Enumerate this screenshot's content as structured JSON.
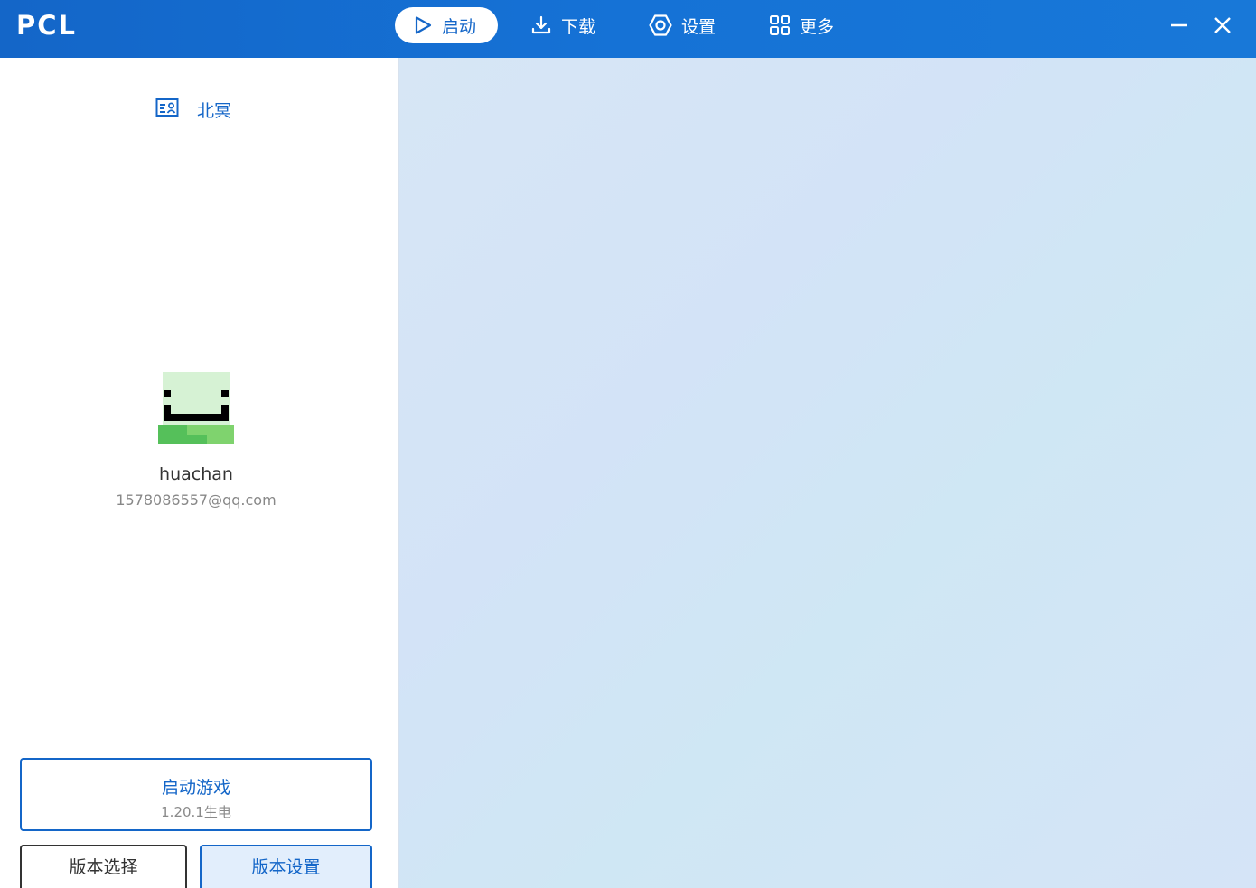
{
  "app": {
    "logo": "PCL"
  },
  "nav": {
    "items": [
      {
        "label": "启动",
        "icon": "play-icon",
        "active": true
      },
      {
        "label": "下载",
        "icon": "download-icon",
        "active": false
      },
      {
        "label": "设置",
        "icon": "settings-icon",
        "active": false
      },
      {
        "label": "更多",
        "icon": "grid-icon",
        "active": false
      }
    ]
  },
  "window_controls": {
    "minimize_icon": "minimize-icon",
    "close_icon": "close-icon"
  },
  "profile": {
    "link_label": "北冥",
    "link_icon": "id-card-icon",
    "username": "huachan",
    "email": "1578086557@qq.com"
  },
  "launch": {
    "title": "启动游戏",
    "version": "1.20.1生电"
  },
  "version_buttons": {
    "select_label": "版本选择",
    "settings_label": "版本设置"
  },
  "colors": {
    "accent": "#1466c8",
    "titlebar": "#1572d6",
    "content_bg": "#d5e4f6"
  }
}
